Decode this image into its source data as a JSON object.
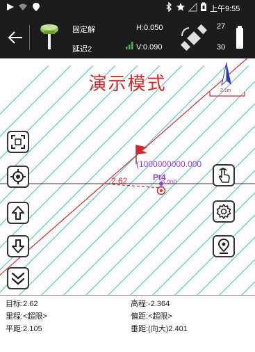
{
  "status": {
    "time": "上午9:55"
  },
  "toolbar": {
    "solution": "固定解",
    "delay": "延迟2",
    "h_precision": "H:0.050",
    "v_precision": "V:0.090",
    "satellites_used": "27",
    "satellites_visible": "30"
  },
  "map": {
    "demo_label": "演示模式",
    "scale_label": "2.1m",
    "distance_label": "2.62",
    "coordinate_label": "(1000000000.000",
    "point_label": "Pt4",
    "point_sub_label": "0.000"
  },
  "info": {
    "target": "目标:2.62",
    "elevation": "高程:-2.364",
    "mileage": "里程:<超限>",
    "offset": "偏距:<超限>",
    "horizontal_distance": "平距:2.105",
    "vertical_distance": "垂距:(向大)2.401"
  },
  "colors": {
    "bar": "#1c1c1c",
    "hatch": "#4bb6d6",
    "redline": "#d42a2a",
    "purple": "#9b3fc4",
    "signal": "#4caf50"
  }
}
